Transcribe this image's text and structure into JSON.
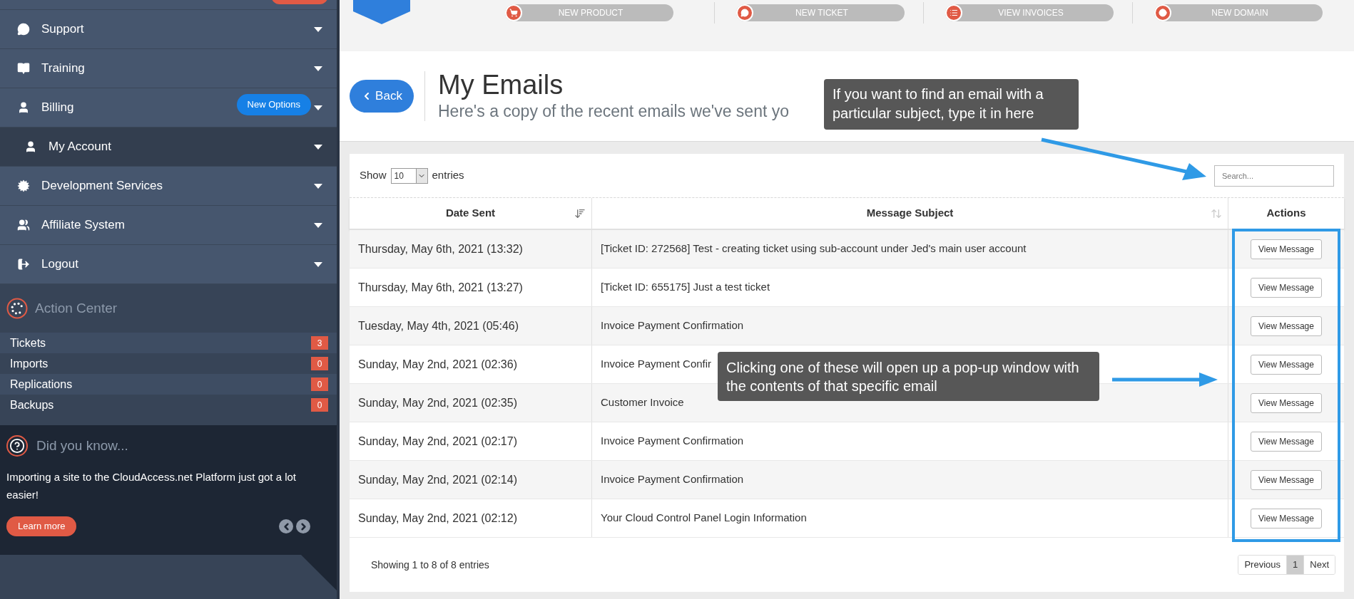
{
  "sidebar": {
    "menu": [
      {
        "label": "Support",
        "selected": false
      },
      {
        "label": "Training",
        "selected": false
      },
      {
        "label": "Billing",
        "selected": false,
        "badge": "New Options",
        "children": [
          {
            "label": "My Account",
            "selected": true
          }
        ]
      },
      {
        "label": "Development Services",
        "selected": false
      },
      {
        "label": "Affiliate System",
        "selected": false
      },
      {
        "label": "Logout",
        "selected": false
      }
    ],
    "action_center": {
      "title": "Action Center",
      "items": [
        {
          "label": "Tickets",
          "count": "3"
        },
        {
          "label": "Imports",
          "count": "0"
        },
        {
          "label": "Replications",
          "count": "0"
        },
        {
          "label": "Backups",
          "count": "0"
        }
      ]
    },
    "did_you_know": {
      "title": "Did you know...",
      "text": "Importing a site to the CloudAccess.net Platform just got a lot easier!",
      "button": "Learn more"
    }
  },
  "quick_links": [
    {
      "label": "NEW PRODUCT"
    },
    {
      "label": "NEW TICKET"
    },
    {
      "label": "VIEW INVOICES"
    },
    {
      "label": "NEW DOMAIN"
    }
  ],
  "header": {
    "back": "Back",
    "title": "My Emails",
    "subtitle": "Here's a copy of the recent emails we've sent yo"
  },
  "table": {
    "show_label": "Show",
    "page_size": "10",
    "entries_label": "entries",
    "search": {
      "placeholder": "Search..."
    },
    "columns": [
      "Date Sent",
      "Message Subject",
      "Actions"
    ],
    "rows": [
      {
        "date": "Thursday, May 6th, 2021 (13:32)",
        "subject": "[Ticket ID: 272568] Test - creating ticket using sub-account under Jed's main user account",
        "action": "View Message"
      },
      {
        "date": "Thursday, May 6th, 2021 (13:27)",
        "subject": "[Ticket ID: 655175] Just a test ticket",
        "action": "View Message"
      },
      {
        "date": "Tuesday, May 4th, 2021 (05:46)",
        "subject": "Invoice Payment Confirmation",
        "action": "View Message"
      },
      {
        "date": "Sunday, May 2nd, 2021 (02:36)",
        "subject": "Invoice Payment Confir",
        "action": "View Message"
      },
      {
        "date": "Sunday, May 2nd, 2021 (02:35)",
        "subject": "Customer Invoice",
        "action": "View Message"
      },
      {
        "date": "Sunday, May 2nd, 2021 (02:17)",
        "subject": "Invoice Payment Confirmation",
        "action": "View Message"
      },
      {
        "date": "Sunday, May 2nd, 2021 (02:14)",
        "subject": "Invoice Payment Confirmation",
        "action": "View Message"
      },
      {
        "date": "Sunday, May 2nd, 2021 (02:12)",
        "subject": "Your Cloud Control Panel Login Information",
        "action": "View Message"
      }
    ],
    "footer": "Showing 1 to 8 of 8 entries",
    "pagination": [
      {
        "label": "Previous",
        "selected": false
      },
      {
        "label": "1",
        "selected": true
      },
      {
        "label": "Next",
        "selected": false
      }
    ]
  },
  "annotations": [
    {
      "text": "If you want to find an email with a particular subject, type it in here"
    },
    {
      "text": "Clicking one of these will open up a pop-up window with the contents of that specific email"
    }
  ]
}
